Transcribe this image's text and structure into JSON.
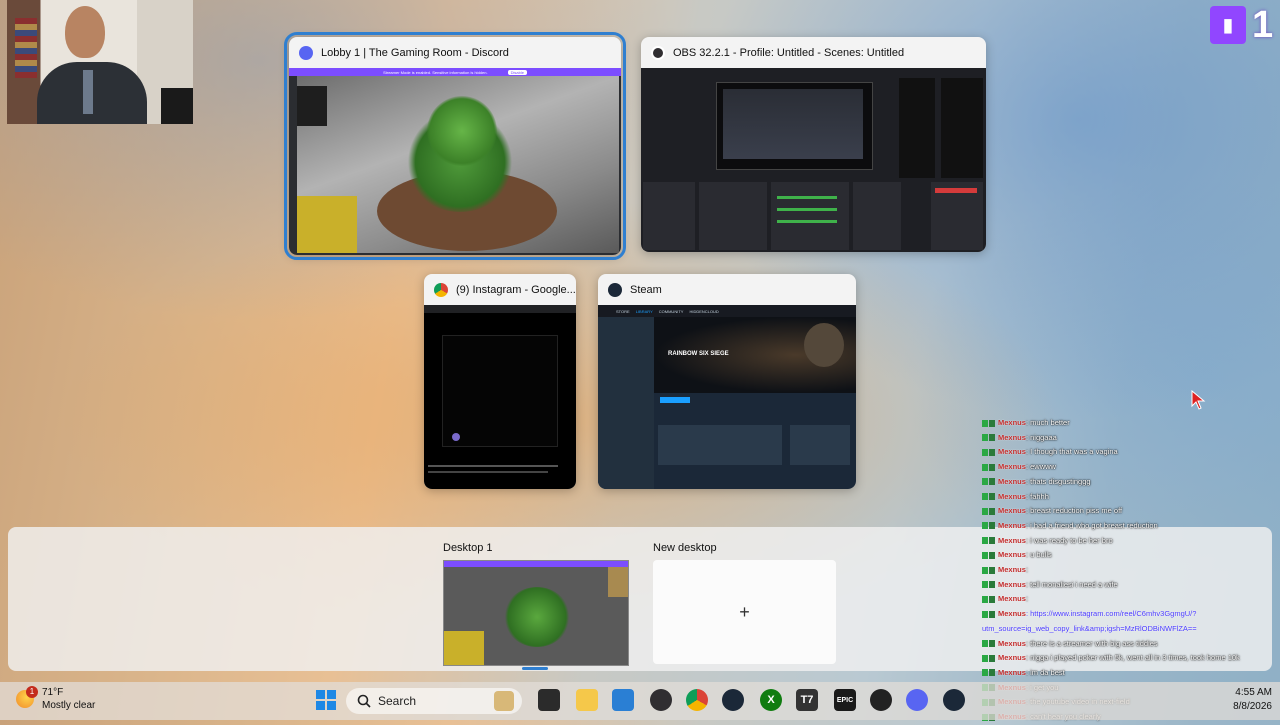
{
  "windows": {
    "discord": {
      "title": "Lobby 1 | The Gaming Room - Discord",
      "banner": "Streamer Mode is enabled. Sensitive information is hidden.",
      "banner_button": "Disable"
    },
    "obs": {
      "title": "OBS 32.2.1 - Profile: Untitled - Scenes: Untitled"
    },
    "instagram": {
      "title": "(9) Instagram - Google..."
    },
    "steam": {
      "title": "Steam",
      "game": "RAINBOW SIX SIEGE",
      "nav": [
        "STORE",
        "LIBRARY",
        "COMMUNITY",
        "HIDDENCLOUD"
      ]
    }
  },
  "desktops": {
    "desktop1_label": "Desktop 1",
    "new_label": "New desktop",
    "new_symbol": "+"
  },
  "webcam_name": "webcam-feed",
  "twitch": {
    "viewer_count": "1"
  },
  "chat": [
    {
      "user": "Mexnus",
      "msg": ": much better"
    },
    {
      "user": "Mexnus",
      "msg": ": niggaaa"
    },
    {
      "user": "Mexnus",
      "msg": ": I though that was a vagina"
    },
    {
      "user": "Mexnus",
      "msg": ": ewwww"
    },
    {
      "user": "Mexnus",
      "msg": ": thats disgustinggg"
    },
    {
      "user": "Mexnus",
      "msg": ": fahhh"
    },
    {
      "user": "Mexnus",
      "msg": ": breast reduction piss me off"
    },
    {
      "user": "Mexnus",
      "msg": ": i had a friend who got breast reduction"
    },
    {
      "user": "Mexnus",
      "msg": ": i was ready to be her bro"
    },
    {
      "user": "Mexnus",
      "msg": ": u bulls"
    },
    {
      "user": "Mexnus",
      "msg": ": "
    },
    {
      "user": "Mexnus",
      "msg": ": tell monaliesi i need a wife"
    },
    {
      "user": "Mexnus",
      "msg": ": "
    },
    {
      "user": "Mexnus",
      "msg": ": https://www.instagram.com/reel/C6mhv3GgmgU/?",
      "link": true
    },
    {
      "user": "",
      "msg": "utm_source=ig_web_copy_link&amp;igsh=MzRlODBiNWFlZA==",
      "link": true
    },
    {
      "user": "Mexnus",
      "msg": ": there is a streamer with big ass tiddies"
    },
    {
      "user": "Mexnus",
      "msg": ": nigga i played poker with 5k, went all in 3 times, took home 10k"
    },
    {
      "user": "Mexnus",
      "msg": ": im da best"
    },
    {
      "user": "Mexnus",
      "msg": ": i get you"
    },
    {
      "user": "Mexnus",
      "msg": ": the youtube video in next-field"
    },
    {
      "user": "Mexnus",
      "msg": ": can't hear you clearly"
    }
  ],
  "taskbar": {
    "weather_temp": "71°F",
    "weather_desc": "Mostly clear",
    "weather_badge": "1",
    "search_placeholder": "Search",
    "time": "4:55 AM",
    "date": "8/8/2026",
    "icons": [
      "windows-start-icon",
      "search-icon",
      "task-view-icon",
      "file-explorer-icon",
      "microsoft-store-icon",
      "obs-icon",
      "chrome-icon",
      "steam-icon",
      "xbox-icon",
      "t7-icon",
      "epic-games-icon",
      "circle-app-icon",
      "discord-icon",
      "steam-alt-icon"
    ]
  },
  "colors": {
    "accent": "#2f7fd0",
    "twitch": "#9146ff",
    "discord": "#5865f2",
    "chat_user": "#c22a2a"
  }
}
